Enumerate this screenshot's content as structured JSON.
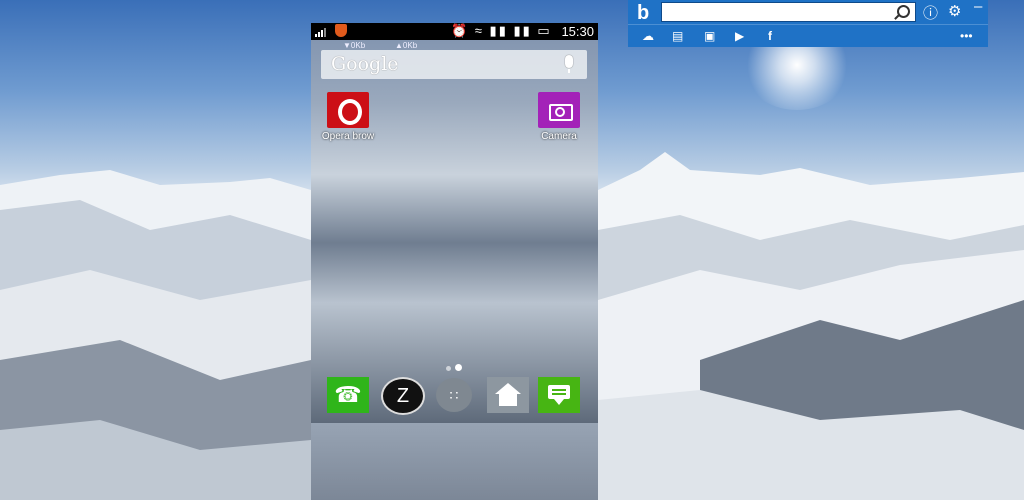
{
  "phone": {
    "status_bar": {
      "time": "15:30"
    },
    "net_speed": {
      "down": "0Kb",
      "up": "0Kb"
    },
    "search_widget": {
      "logo_text": "Google"
    },
    "apps": [
      {
        "label": "Opera brow",
        "color": "#cc0f16"
      },
      {
        "label": "Camera",
        "color": "#a322b8"
      }
    ],
    "dock": {
      "launcher_letter": "Z",
      "apps_glyph": "∷"
    }
  },
  "bing_bar": {
    "logo": "b",
    "search_placeholder": "",
    "info_icon": "ⓘ",
    "settings_icon": "⚙",
    "minimize": "–",
    "more": "•••",
    "toolbar_icons": [
      "weather-icon",
      "news-icon",
      "images-icon",
      "video-icon",
      "facebook-icon"
    ]
  }
}
